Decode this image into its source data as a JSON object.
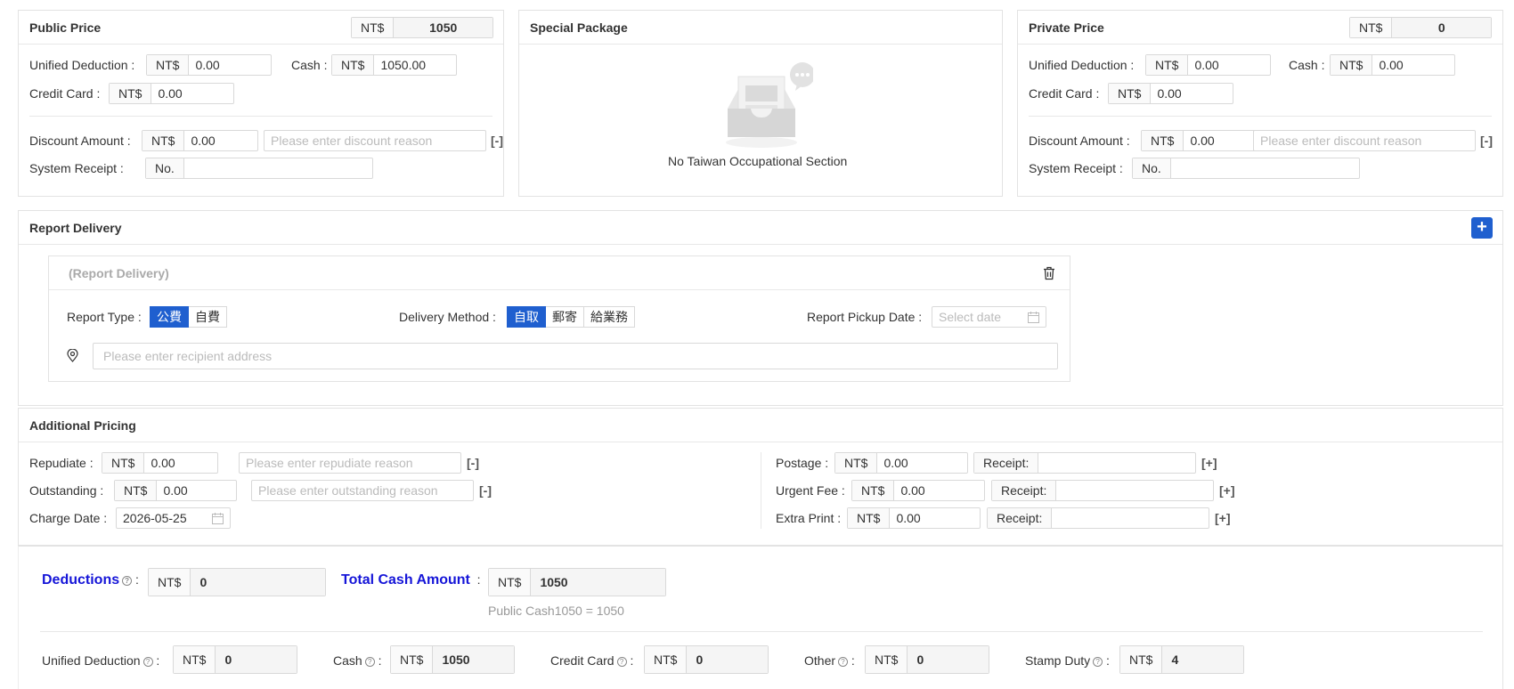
{
  "public_price": {
    "title": "Public Price",
    "currency": "NT$",
    "total": "1050",
    "unified_deduction_label": "Unified Deduction",
    "unified_deduction": "0.00",
    "cash_label": "Cash",
    "cash": "1050.00",
    "credit_card_label": "Credit Card",
    "credit_card": "0.00",
    "discount_label": "Discount Amount",
    "discount": "0.00",
    "discount_reason_placeholder": "Please enter discount reason",
    "discount_toggle": "[-]",
    "receipt_label": "System Receipt",
    "receipt_prefix": "No.",
    "receipt_value": ""
  },
  "special_package": {
    "title": "Special Package",
    "empty_text": "No Taiwan Occupational Section"
  },
  "private_price": {
    "title": "Private Price",
    "currency": "NT$",
    "total": "0",
    "unified_deduction_label": "Unified Deduction",
    "unified_deduction": "0.00",
    "cash_label": "Cash",
    "cash": "0.00",
    "credit_card_label": "Credit Card",
    "credit_card": "0.00",
    "discount_label": "Discount Amount",
    "discount": "0.00",
    "discount_reason_placeholder": "Please enter discount reason",
    "discount_toggle": "[-]",
    "receipt_label": "System Receipt",
    "receipt_prefix": "No.",
    "receipt_value": ""
  },
  "report_delivery": {
    "title": "Report Delivery",
    "add_button": "+",
    "item": {
      "title": "(Report Delivery)",
      "report_type_label": "Report Type",
      "report_type_options": [
        "公費",
        "自費"
      ],
      "report_type_selected": 0,
      "delivery_method_label": "Delivery Method",
      "delivery_method_options": [
        "自取",
        "郵寄",
        "給業務"
      ],
      "delivery_method_selected": 0,
      "pickup_date_label": "Report Pickup Date",
      "pickup_date_placeholder": "Select date",
      "address_placeholder": "Please enter recipient address"
    }
  },
  "additional_pricing": {
    "title": "Additional Pricing",
    "currency": "NT$",
    "repudiate_label": "Repudiate",
    "repudiate": "0.00",
    "repudiate_reason_placeholder": "Please enter repudiate reason",
    "repudiate_toggle": "[-]",
    "outstanding_label": "Outstanding",
    "outstanding": "0.00",
    "outstanding_reason_placeholder": "Please enter outstanding reason",
    "outstanding_toggle": "[-]",
    "charge_date_label": "Charge Date",
    "charge_date": "2026-05-25",
    "postage_label": "Postage",
    "postage": "0.00",
    "urgent_label": "Urgent Fee",
    "urgent": "0.00",
    "extra_print_label": "Extra Print",
    "extra_print": "0.00",
    "receipt_label": "Receipt:",
    "add_toggle": "[+]"
  },
  "summary": {
    "currency": "NT$",
    "deductions_label": "Deductions",
    "deductions": "0",
    "total_cash_label": "Total Cash Amount",
    "total_cash": "1050",
    "formula": "Public Cash1050 = 1050",
    "unified_deduction_label": "Unified Deduction",
    "unified_deduction": "0",
    "cash_label": "Cash",
    "cash": "1050",
    "credit_card_label": "Credit Card",
    "credit_card": "0",
    "other_label": "Other",
    "other": "0",
    "stamp_duty_label": "Stamp Duty",
    "stamp_duty": "4"
  },
  "colors": {
    "primary": "#1f5fcf",
    "summary_label": "#1515d8"
  }
}
